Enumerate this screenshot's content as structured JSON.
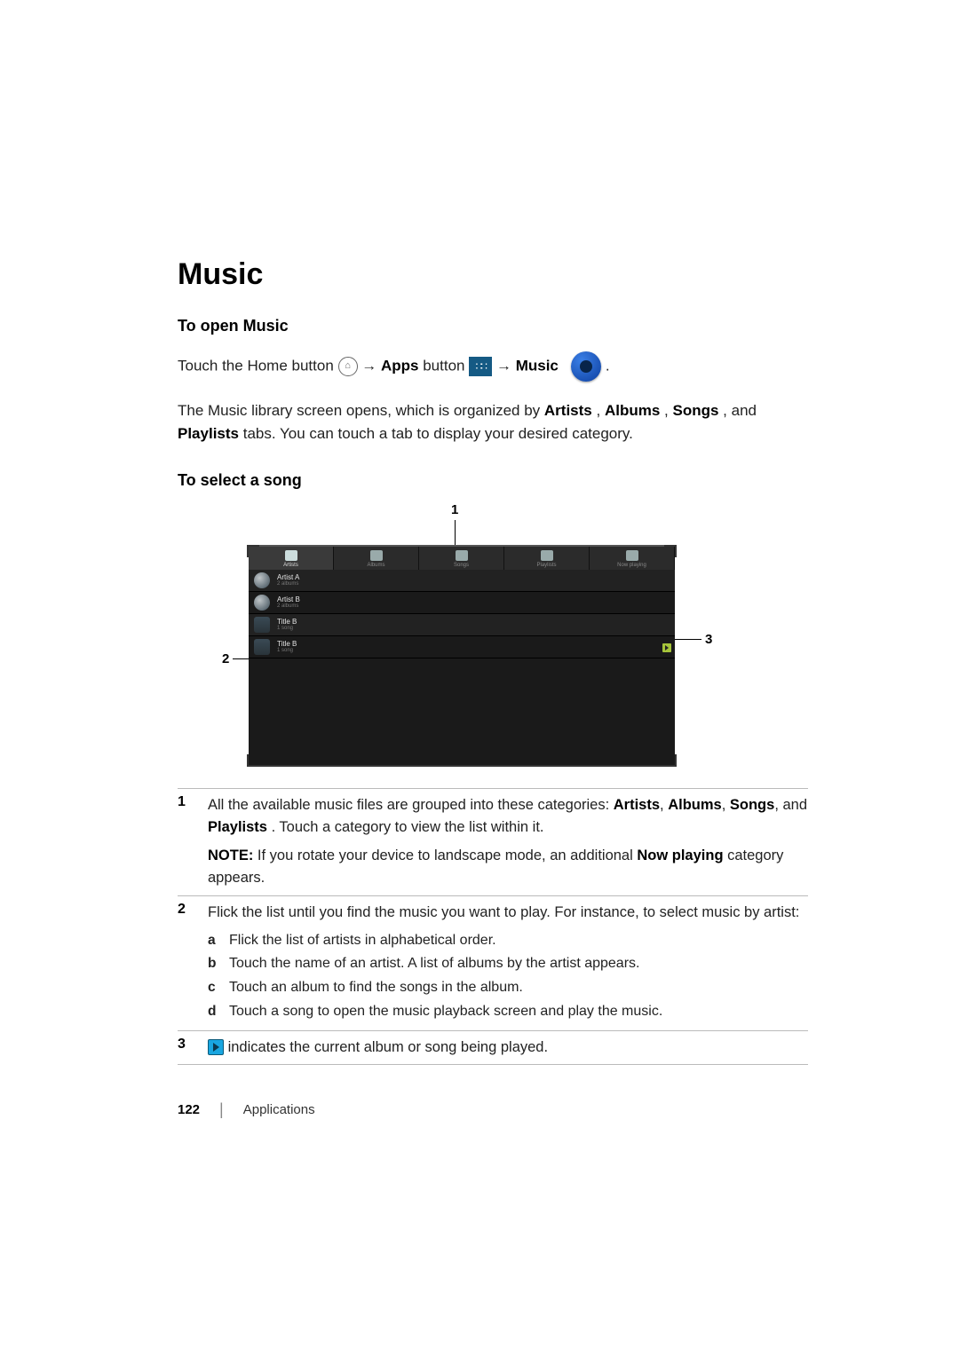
{
  "title": "Music",
  "section_open": {
    "heading": "To open Music",
    "line_prefix": "Touch the Home button ",
    "apps_word": "Apps",
    "button_word": " button ",
    "music_word": "Music",
    "line_suffix": " .",
    "library_text_1": "The Music library screen opens, which is organized by ",
    "lib_artists": "Artists",
    "lib_sep1": ", ",
    "lib_albums": "Albums",
    "lib_sep2": ", ",
    "lib_songs": "Songs",
    "lib_and": ", and ",
    "lib_playlists": "Playlists",
    "library_text_2": " tabs. You can touch a tab to display your desired category."
  },
  "section_select": {
    "heading": "To select a song"
  },
  "callouts": {
    "one": "1",
    "two": "2",
    "three": "3"
  },
  "screenshot": {
    "tabs": [
      {
        "label": "Artists"
      },
      {
        "label": "Albums"
      },
      {
        "label": "Songs"
      },
      {
        "label": "Playlists"
      },
      {
        "label": "Now playing"
      }
    ],
    "rows": [
      {
        "title": "Artist A",
        "sub": "2 albums",
        "avatar": "round"
      },
      {
        "title": "Artist B",
        "sub": "2 albums",
        "avatar": "round"
      },
      {
        "title": "Title B",
        "sub": "1 song",
        "avatar": "square"
      },
      {
        "title": "Title B",
        "sub": "1 song",
        "avatar": "square",
        "playing": true
      }
    ]
  },
  "numlist": {
    "r1": {
      "num": "1",
      "t1": "All the available music files are grouped into these categories: ",
      "b1": "Artists",
      "s1": ", ",
      "b2": "Albums",
      "s2": ", ",
      "b3": "Songs",
      "s3": ", and ",
      "b4": "Playlists",
      "t2": ". Touch a category to view the list within it.",
      "note_lead": "NOTE: ",
      "note_t1": "If you rotate your device to landscape mode, an additional ",
      "note_b": "Now playing",
      "note_t2": " category appears."
    },
    "r2": {
      "num": "2",
      "lead": "Flick the list until you find the music you want to play. For instance, to select music by artist:",
      "a": "Flick the list of artists in alphabetical order.",
      "b": "Touch the name of an artist. A list of albums by the artist appears.",
      "c": "Touch an album to find the songs in the album.",
      "d": "Touch a song to open the music playback screen and play the music."
    },
    "r3": {
      "num": "3",
      "text": " indicates the current album or song being played."
    }
  },
  "footer": {
    "page": "122",
    "section": "Applications"
  }
}
